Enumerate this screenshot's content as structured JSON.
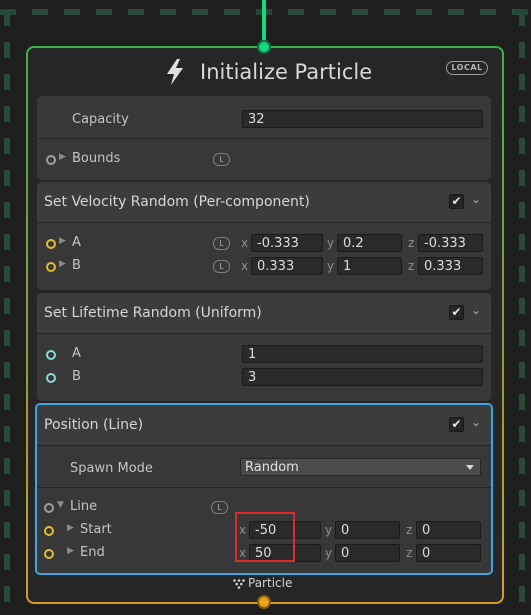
{
  "node": {
    "title": "Initialize Particle",
    "space_badge": "LOCAL",
    "capacity": {
      "label": "Capacity",
      "value": "32"
    },
    "bounds": {
      "label": "Bounds",
      "badge": "L"
    }
  },
  "blocks": {
    "velocity": {
      "title": "Set Velocity Random (Per-component)",
      "rows": [
        {
          "label": "A",
          "badge": "L",
          "x_axis": "x",
          "x": "-0.333",
          "y_axis": "y",
          "y": "0.2",
          "z_axis": "z",
          "z": "-0.333"
        },
        {
          "label": "B",
          "badge": "L",
          "x_axis": "x",
          "x": "0.333",
          "y_axis": "y",
          "y": "1",
          "z_axis": "z",
          "z": "0.333"
        }
      ]
    },
    "lifetime": {
      "title": "Set Lifetime Random (Uniform)",
      "rows": [
        {
          "label": "A",
          "value": "1"
        },
        {
          "label": "B",
          "value": "3"
        }
      ]
    },
    "position": {
      "title": "Position (Line)",
      "spawn_mode_label": "Spawn Mode",
      "spawn_mode_value": "Random",
      "line_label": "Line",
      "line_badge": "L",
      "start": {
        "label": "Start",
        "x_axis": "x",
        "x": "-50",
        "y_axis": "y",
        "y": "0",
        "z_axis": "z",
        "z": "0"
      },
      "end": {
        "label": "End",
        "x_axis": "x",
        "x": "50",
        "y_axis": "y",
        "y": "0",
        "z_axis": "z",
        "z": "0"
      }
    }
  },
  "footer": {
    "label": "Particle"
  },
  "colors": {
    "flow_in": "#16d97d",
    "flow_out": "#e7a41c",
    "selection": "#3da6e2",
    "highlight": "#dd2b2b"
  },
  "icons": {
    "title": "lightning-bolt-icon",
    "checkbox": "checkmark-icon",
    "collapse": "chevron-down-icon",
    "footer": "particle-dots-icon"
  }
}
